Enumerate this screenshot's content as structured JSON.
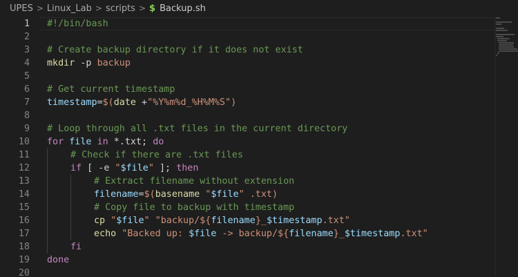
{
  "breadcrumb": {
    "items": [
      "UPES",
      "Linux_Lab",
      "scripts"
    ],
    "file": "Backup.sh",
    "file_icon": "$",
    "separator": ">"
  },
  "editor": {
    "language": "shellscript",
    "active_line": 1,
    "lines": [
      {
        "n": "1",
        "indent": 0,
        "tokens": [
          {
            "c": "com",
            "t": "#!/bin/bash"
          }
        ]
      },
      {
        "n": "2",
        "indent": 0,
        "tokens": []
      },
      {
        "n": "3",
        "indent": 0,
        "tokens": [
          {
            "c": "com",
            "t": "# Create backup directory if it does not exist"
          }
        ]
      },
      {
        "n": "4",
        "indent": 0,
        "tokens": [
          {
            "c": "cmd",
            "t": "mkdir"
          },
          {
            "c": "flag",
            "t": " -p "
          },
          {
            "c": "str",
            "t": "backup"
          }
        ]
      },
      {
        "n": "5",
        "indent": 0,
        "tokens": []
      },
      {
        "n": "6",
        "indent": 0,
        "tokens": [
          {
            "c": "com",
            "t": "# Get current timestamp"
          }
        ]
      },
      {
        "n": "7",
        "indent": 0,
        "tokens": [
          {
            "c": "var",
            "t": "timestamp"
          },
          {
            "c": "op",
            "t": "="
          },
          {
            "c": "str",
            "t": "$("
          },
          {
            "c": "cmd",
            "t": "date"
          },
          {
            "c": "op",
            "t": " +"
          },
          {
            "c": "str",
            "t": "\"%Y%m%d_%H%M%S\""
          },
          {
            "c": "str",
            "t": ")"
          }
        ]
      },
      {
        "n": "8",
        "indent": 0,
        "tokens": []
      },
      {
        "n": "9",
        "indent": 0,
        "tokens": [
          {
            "c": "com",
            "t": "# Loop through all .txt files in the current directory"
          }
        ]
      },
      {
        "n": "10",
        "indent": 0,
        "tokens": [
          {
            "c": "kw",
            "t": "for"
          },
          {
            "c": "op",
            "t": " "
          },
          {
            "c": "var",
            "t": "file"
          },
          {
            "c": "op",
            "t": " "
          },
          {
            "c": "kw",
            "t": "in"
          },
          {
            "c": "op",
            "t": " *.txt; "
          },
          {
            "c": "kw",
            "t": "do"
          }
        ]
      },
      {
        "n": "11",
        "indent": 1,
        "tokens": [
          {
            "c": "com",
            "t": "# Check if there are .txt files"
          }
        ]
      },
      {
        "n": "12",
        "indent": 1,
        "tokens": [
          {
            "c": "kw",
            "t": "if"
          },
          {
            "c": "op",
            "t": " [ -e "
          },
          {
            "c": "str",
            "t": "\""
          },
          {
            "c": "var",
            "t": "$file"
          },
          {
            "c": "str",
            "t": "\""
          },
          {
            "c": "op",
            "t": " ]; "
          },
          {
            "c": "kw",
            "t": "then"
          }
        ]
      },
      {
        "n": "13",
        "indent": 2,
        "tokens": [
          {
            "c": "com",
            "t": "# Extract filename without extension"
          }
        ]
      },
      {
        "n": "14",
        "indent": 2,
        "tokens": [
          {
            "c": "var",
            "t": "filename"
          },
          {
            "c": "op",
            "t": "="
          },
          {
            "c": "str",
            "t": "$("
          },
          {
            "c": "cmd",
            "t": "basename"
          },
          {
            "c": "op",
            "t": " "
          },
          {
            "c": "str",
            "t": "\""
          },
          {
            "c": "var",
            "t": "$file"
          },
          {
            "c": "str",
            "t": "\""
          },
          {
            "c": "op",
            "t": " "
          },
          {
            "c": "str",
            "t": ".txt)"
          }
        ]
      },
      {
        "n": "15",
        "indent": 2,
        "tokens": [
          {
            "c": "com",
            "t": "# Copy file to backup with timestamp"
          }
        ]
      },
      {
        "n": "16",
        "indent": 2,
        "tokens": [
          {
            "c": "cmd",
            "t": "cp"
          },
          {
            "c": "op",
            "t": " "
          },
          {
            "c": "str",
            "t": "\""
          },
          {
            "c": "var",
            "t": "$file"
          },
          {
            "c": "str",
            "t": "\""
          },
          {
            "c": "op",
            "t": " "
          },
          {
            "c": "str",
            "t": "\"backup/${"
          },
          {
            "c": "var",
            "t": "filename"
          },
          {
            "c": "str",
            "t": "}_"
          },
          {
            "c": "var",
            "t": "$timestamp"
          },
          {
            "c": "str",
            "t": ".txt\""
          }
        ]
      },
      {
        "n": "17",
        "indent": 2,
        "tokens": [
          {
            "c": "cmd",
            "t": "echo"
          },
          {
            "c": "op",
            "t": " "
          },
          {
            "c": "str",
            "t": "\"Backed up: "
          },
          {
            "c": "var",
            "t": "$file"
          },
          {
            "c": "str",
            "t": " -> backup/${"
          },
          {
            "c": "var",
            "t": "filename"
          },
          {
            "c": "str",
            "t": "}_"
          },
          {
            "c": "var",
            "t": "$timestamp"
          },
          {
            "c": "str",
            "t": ".txt\""
          }
        ]
      },
      {
        "n": "18",
        "indent": 1,
        "tokens": [
          {
            "c": "kw",
            "t": "fi"
          }
        ]
      },
      {
        "n": "19",
        "indent": 0,
        "tokens": [
          {
            "c": "kw",
            "t": "done"
          }
        ]
      },
      {
        "n": "20",
        "indent": 0,
        "tokens": []
      }
    ]
  },
  "colors": {
    "background": "#1e1e1e",
    "comment": "#6a9955",
    "keyword": "#c586c0",
    "variable": "#9cdcfe",
    "command": "#dcdcaa",
    "string": "#ce9178",
    "line_number": "#858585",
    "line_number_active": "#c6c6c6"
  }
}
